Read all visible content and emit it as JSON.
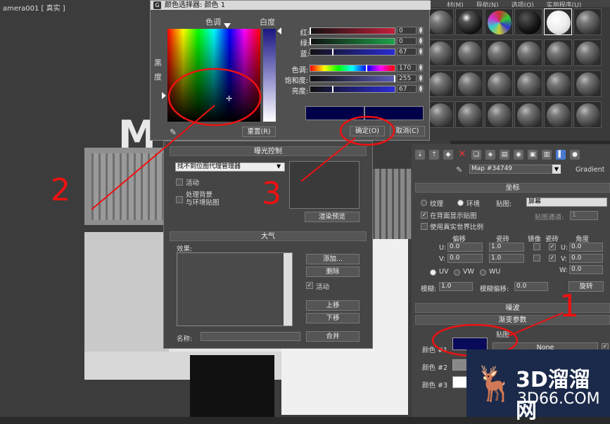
{
  "viewport": {
    "label": "amera001 [ 真实 ]",
    "sign_letter": "M"
  },
  "material_slots": {
    "menu": [
      "材(M)",
      "导航(N)",
      "选项(O)",
      "实用程序(U)"
    ]
  },
  "color_picker": {
    "title": "颜色选择器: 颜色 1",
    "hue_label": "色调",
    "white_label": "白度",
    "black_label": "黑",
    "degree_label": "度",
    "reset_button": "重置(R)",
    "ok_button": "确定(O)",
    "cancel_button": "取消(C)",
    "sliders": [
      {
        "name": "红:",
        "value": "0",
        "color": "#c21f3a"
      },
      {
        "name": "绿:",
        "value": "0",
        "color": "#1ea34a"
      },
      {
        "name": "蓝:",
        "value": "67",
        "color": "#2b2bd6"
      },
      {
        "name": "色调:",
        "value": "170",
        "color": "hue"
      },
      {
        "name": "饱和度:",
        "value": "255",
        "color": "#5a5ab5"
      },
      {
        "name": "亮度:",
        "value": "67",
        "color": "#2b2bd6"
      }
    ],
    "current_color": "#00004a",
    "old_color": "#00004a"
  },
  "render_setup": {
    "exposure_header": "曝光控制",
    "exposure_dropdown": "找不到位图代理管理器",
    "active_label": "活动",
    "process_bg_line1": "处理背景",
    "process_bg_line2": "与环境贴图",
    "render_preview": "渲染预览",
    "atmosphere_header": "大气",
    "effects_label": "效果:",
    "add_button": "添加...",
    "delete_button": "删除",
    "active_check": "活动",
    "up_button": "上移",
    "down_button": "下移",
    "name_label": "名称:",
    "merge_button": "合并"
  },
  "material_editor": {
    "map_name": "Map #34749",
    "map_type": "Gradient",
    "coords_header": "坐标",
    "texture_label": "纹理",
    "environ_label": "环境",
    "mapping_label": "贴图:",
    "mapping_value": "屏幕",
    "show_in_viewport": "在背面显示贴图",
    "map_channel": "贴图通道:",
    "map_channel_value": "1",
    "real_world": "使用真实世界比例",
    "offset_label": "偏移",
    "tiling_label": "瓷砖",
    "mirror_label": "镜像",
    "tile_label": "瓷砖",
    "angle_label": "角度",
    "u_label": "U:",
    "v_label": "V:",
    "w_label": "W:",
    "u_offset": "0.0",
    "v_offset": "0.0",
    "u_tiling": "1.0",
    "v_tiling": "1.0",
    "u_angle": "0.0",
    "v_angle": "0.0",
    "w_angle": "0.0",
    "uv": "UV",
    "vw": "VW",
    "wu": "WU",
    "rotate_button": "旋转",
    "blur_label": "模糊:",
    "blur_value": "1.0",
    "blur_offset_label": "模糊偏移:",
    "blur_offset_value": "0.0",
    "noise_header": "噪波",
    "gradient_header": "渐变参数",
    "map_header": "贴图",
    "color1_label": "颜色 #1",
    "color2_label": "颜色 #2",
    "color3_label": "颜色 #3",
    "none_label": "None",
    "color1": "#0a0a5a",
    "color2": "#888888",
    "color3": "#ffffff"
  },
  "annotations": {
    "a1": "1",
    "a2": "2",
    "a3": "3"
  },
  "watermark": {
    "line1": "3D溜溜网",
    "line2": "3D66.COM"
  }
}
